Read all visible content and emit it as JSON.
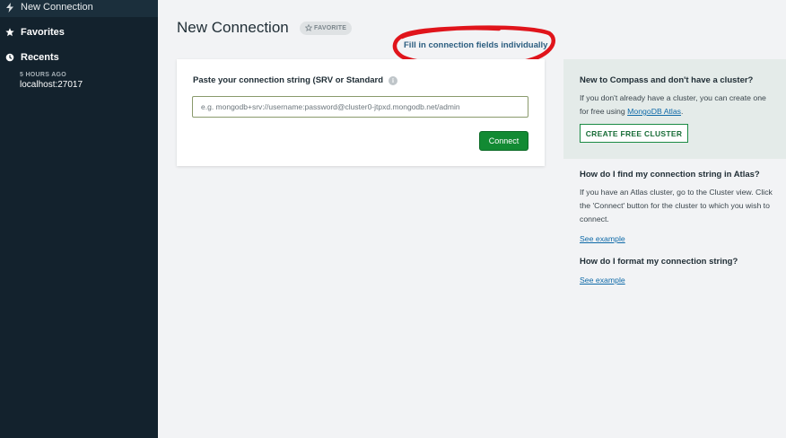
{
  "sidebar": {
    "new_connection": "New Connection",
    "favorites": "Favorites",
    "recents": "Recents",
    "recent_items": [
      {
        "time": "5 HOURS AGO",
        "host": "localhost:27017"
      }
    ]
  },
  "header": {
    "title": "New Connection",
    "favorite_button": "FAVORITE",
    "fill_fields_link": "Fill in connection fields individually"
  },
  "connection_form": {
    "label": "Paste your connection string (SRV or Standard",
    "placeholder": "e.g. mongodb+srv://username:password@cluster0-jtpxd.mongodb.net/admin",
    "value": "",
    "connect_button": "Connect"
  },
  "help": {
    "cluster_box": {
      "heading": "New to Compass and don't have a cluster?",
      "text_before": "If you don't already have a cluster, you can create one for free using ",
      "link": "MongoDB Atlas",
      "text_after": ".",
      "button": "CREATE FREE CLUSTER"
    },
    "find_string": {
      "heading": "How do I find my connection string in Atlas?",
      "text": "If you have an Atlas cluster, go to the Cluster view. Click the 'Connect' button for the cluster to which you wish to connect.",
      "link": "See example"
    },
    "format_string": {
      "heading": "How do I format my connection string?",
      "link": "See example"
    }
  },
  "colors": {
    "sidebar_bg": "#13222d",
    "connect_green": "#128a33",
    "link_blue": "#0f6aa8",
    "annotation_red": "#e0141b"
  },
  "icons": {
    "new_connection": "lightning-icon",
    "favorites": "star-icon",
    "recents": "clock-icon",
    "favorite_button": "star-outline-icon",
    "info": "info-icon"
  }
}
